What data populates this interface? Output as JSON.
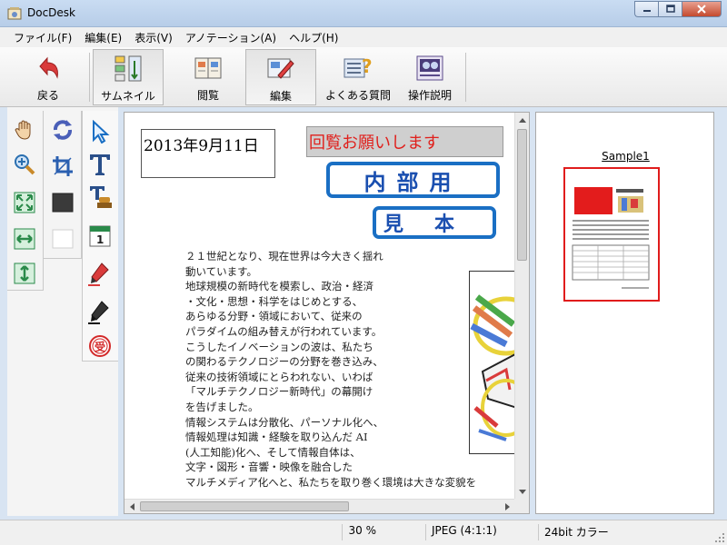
{
  "window": {
    "title": "DocDesk"
  },
  "menu": [
    "ファイル(F)",
    "編集(E)",
    "表示(V)",
    "アノテーション(A)",
    "ヘルプ(H)"
  ],
  "toolbar": {
    "back": "戻る",
    "thumbnail": "サムネイル",
    "view": "閲覧",
    "edit": "編集",
    "faq": "よくある質問",
    "manual": "操作説明"
  },
  "tools": {
    "col_a": [
      "hand-icon",
      "zoom-icon",
      "fit-page-icon",
      "fit-width-icon",
      "fit-height-icon"
    ],
    "col_b": [
      "rotate-icon",
      "crop-icon",
      "fill-black-icon",
      "fill-white-icon"
    ],
    "col_c": [
      "pointer-icon",
      "text-icon",
      "text-stamp-icon",
      "date-stamp-icon",
      "red-marker-icon",
      "black-marker-icon",
      "seal-stamp-icon"
    ]
  },
  "document": {
    "date": "2013年9月11日",
    "circulation": "回覧お願いします",
    "stamp_internal": "内部用",
    "stamp_sample": "見本",
    "seal_char": "受",
    "body_lines": [
      "２１世紀となり、現在世界は今大きく揺れ",
      "動いています。",
      "地球規模の新時代を模索し、政治・経済",
      "・文化・思想・科学をはじめとする、",
      "あらゆる分野・領域において、従来の",
      "パラダイムの組み替えが行われています。",
      "こうしたイノベーションの波は、私たち",
      "の関わるテクノロジーの分野を巻き込み、",
      "従来の技術領域にとらわれない、いわば",
      "「マルチテクノロジー新時代」の幕開け",
      "を告げました。",
      "情報システムは分散化、パーソナル化へ、",
      "情報処理は知識・経験を取り込んだ AI",
      "(人工知能)化へ、そして情報自体は、",
      "文字・図形・音響・映像を融合した",
      "マルチメディア化へと、私たちを取り巻く環境は大きな変貌を"
    ]
  },
  "thumbnail": {
    "label": "Sample1"
  },
  "status": {
    "zoom": "30 %",
    "format": "JPEG (4:1:1)",
    "depth": "24bit カラー"
  }
}
